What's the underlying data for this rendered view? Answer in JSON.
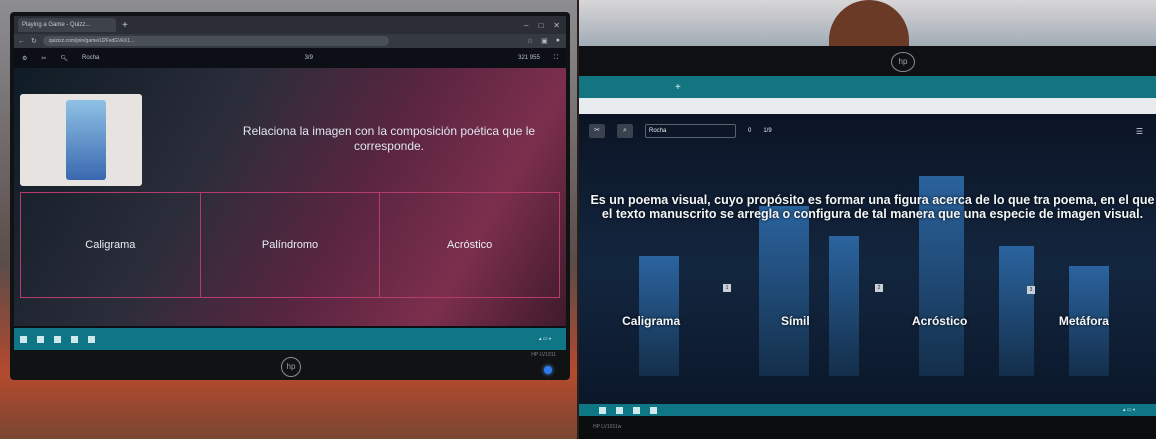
{
  "left": {
    "browser": {
      "tab_title": "Playing a Game - Quizz...",
      "url": "quizizz.com/join/game/U2FsdGVkX1..."
    },
    "quiz_bar": {
      "player": "Rocha",
      "progress": "3/9",
      "score": "321 955"
    },
    "question": "Relaciona la imagen con la composición poética que le corresponde.",
    "answers": [
      "Caligrama",
      "Palíndromo",
      "Acróstico"
    ],
    "brand": "hp",
    "model": "HP LV1911"
  },
  "right": {
    "quiz_bar": {
      "player": "Rocha",
      "streak": "0",
      "progress": "1/9"
    },
    "question": "Es un poema visual, cuyo propósito es formar una figura acerca de lo que tra poema, en el que el texto manuscrito se arregla o configura de tal manera que una especie de imagen visual.",
    "answers": [
      "Caligrama",
      "Símil",
      "Acróstico",
      "Metáfora"
    ],
    "numbers": [
      "1",
      "2",
      "3"
    ],
    "brand": "hp",
    "model": "HP LV1911w"
  }
}
